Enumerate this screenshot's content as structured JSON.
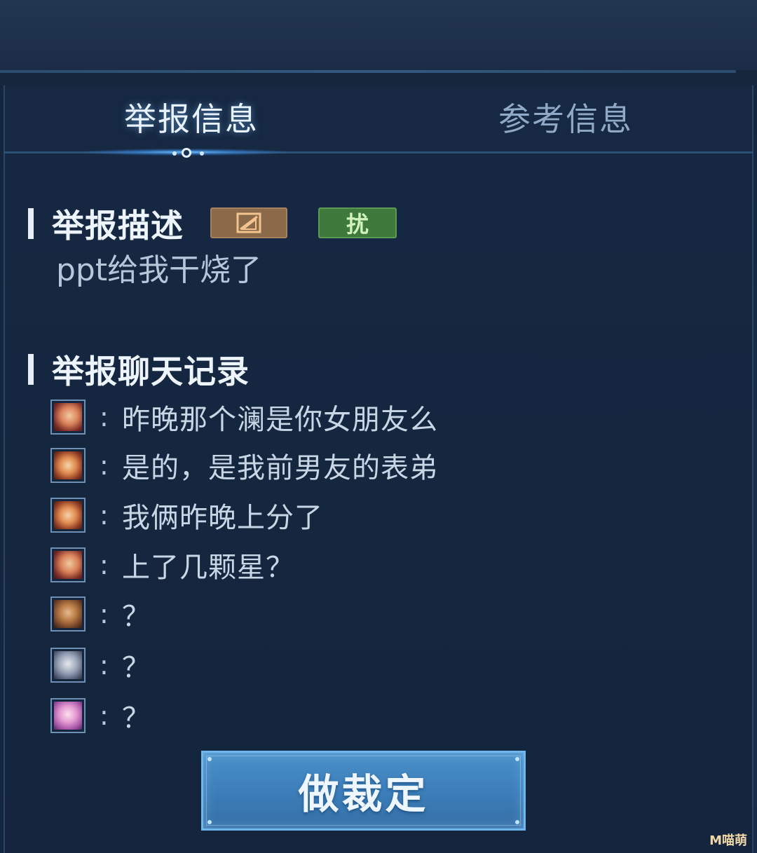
{
  "tabs": [
    {
      "label": "举报信息",
      "active": true
    },
    {
      "label": "参考信息",
      "active": false
    }
  ],
  "report_description": {
    "heading": "举报描述",
    "badges": [
      {
        "label": "图",
        "color": "#8b6a4a"
      },
      {
        "label": "扰",
        "color": "#3f7a3c"
      }
    ],
    "text": "ppt给我干烧了"
  },
  "chat_log": {
    "heading": "举报聊天记录",
    "messages": [
      {
        "avatar": "hero-avatar-1",
        "text": "昨晚那个澜是你女朋友么"
      },
      {
        "avatar": "hero-avatar-2",
        "text": "是的，是我前男友的表弟"
      },
      {
        "avatar": "hero-avatar-2",
        "text": "我俩昨晚上分了"
      },
      {
        "avatar": "hero-avatar-1",
        "text": "上了几颗星？"
      },
      {
        "avatar": "hero-avatar-3",
        "text": "？"
      },
      {
        "avatar": "hero-avatar-4",
        "text": "？"
      },
      {
        "avatar": "hero-avatar-5",
        "text": "？"
      }
    ]
  },
  "actions": {
    "verdict_label": "做裁定"
  },
  "watermark": "M喵萌"
}
